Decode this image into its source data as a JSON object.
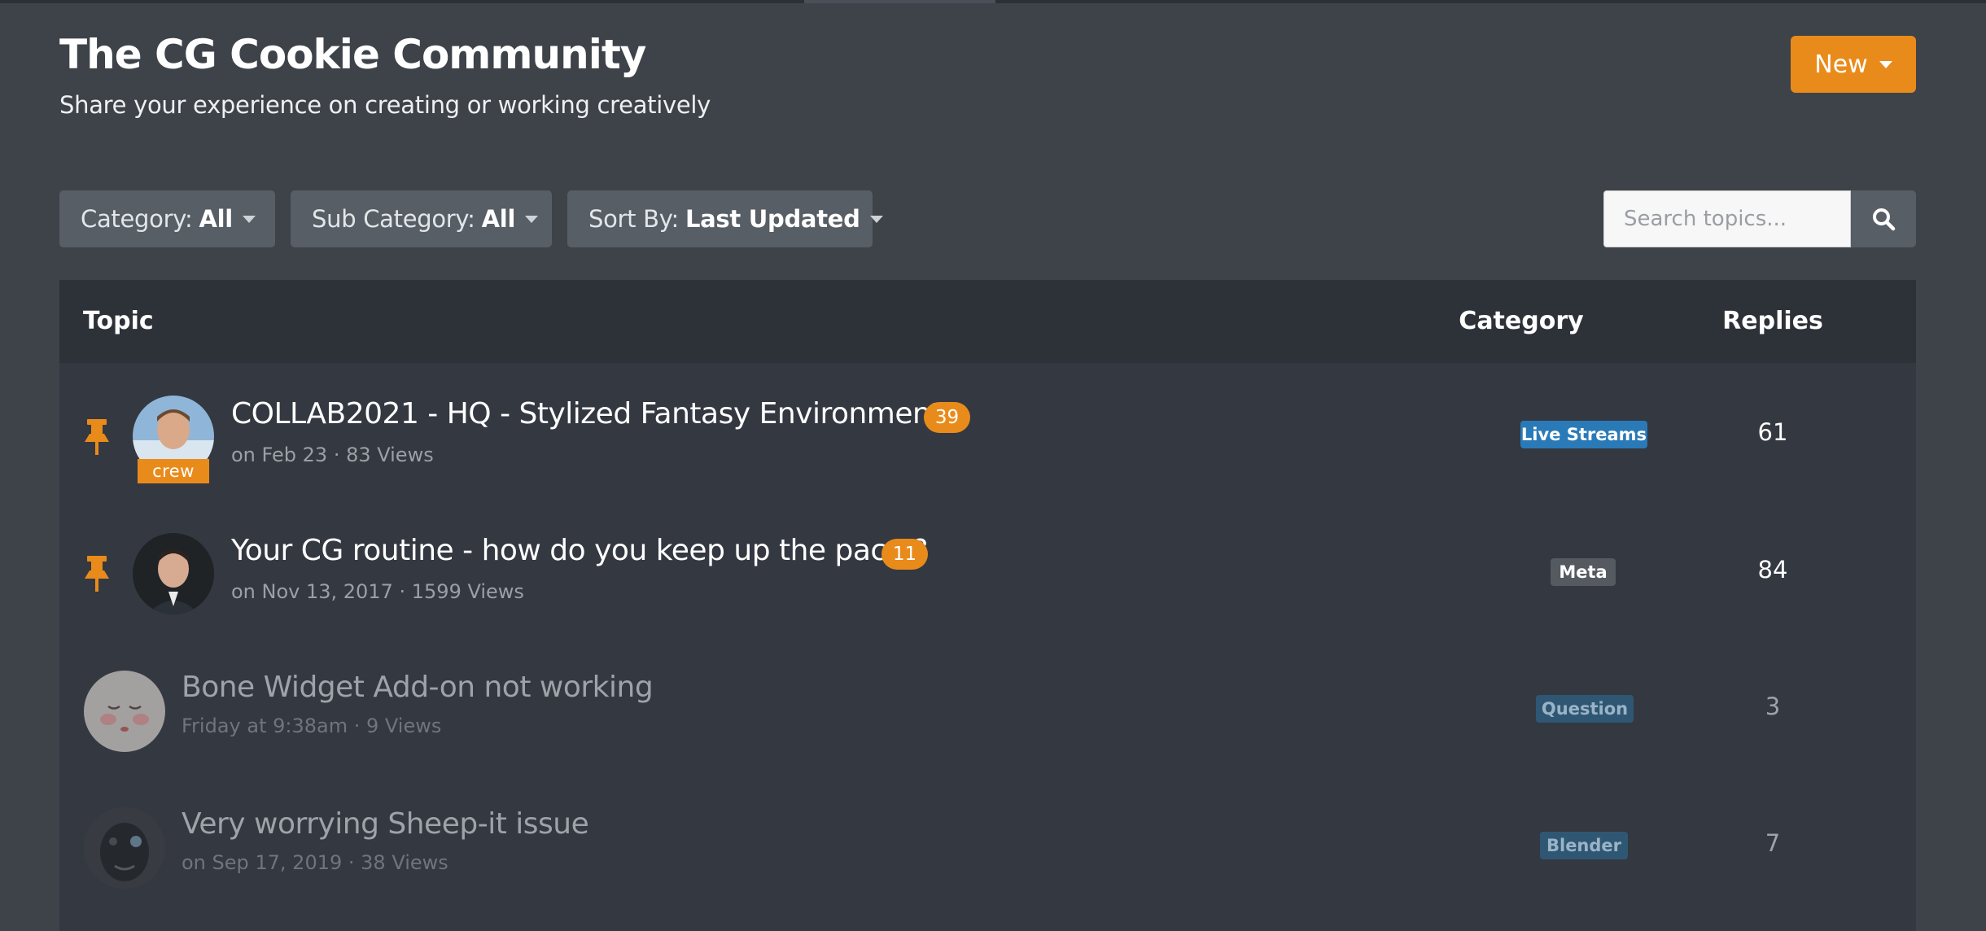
{
  "header": {
    "title": "The CG Cookie Community",
    "subtitle": "Share your experience on creating or working creatively",
    "new_button": "New"
  },
  "filters": {
    "category_label": "Category:",
    "category_value": "All",
    "subcategory_label": "Sub Category:",
    "subcategory_value": "All",
    "sort_label": "Sort By:",
    "sort_value": "Last Updated"
  },
  "search": {
    "placeholder": "Search topics...",
    "value": ""
  },
  "table": {
    "columns": {
      "topic": "Topic",
      "category": "Category",
      "replies": "Replies"
    },
    "rows": [
      {
        "title": "COLLAB2021 - HQ - Stylized Fantasy Environment",
        "meta": "on Feb 23 · 83 Views",
        "pinned": true,
        "new_count": "39",
        "avatar_badge": "crew",
        "category": "Live Streams",
        "category_color": "#2a7ab8",
        "replies": "61"
      },
      {
        "title": "Your CG routine - how do you keep up the pace ?",
        "meta": "on Nov 13, 2017 · 1599 Views",
        "pinned": true,
        "new_count": "11",
        "category": "Meta",
        "category_color": "#555a61",
        "replies": "84"
      },
      {
        "title": "Bone Widget Add-on not working",
        "meta": "Friday at 9:38am · 9 Views",
        "pinned": false,
        "category": "Question",
        "category_color": "#2f5774",
        "replies": "3"
      },
      {
        "title": "Very worrying Sheep-it issue",
        "meta": "on Sep 17, 2019 · 38 Views",
        "pinned": false,
        "category": "Blender",
        "category_color": "#2f5774",
        "replies": "7"
      }
    ]
  },
  "colors": {
    "accent": "#e98b1b",
    "background": "#3e4349",
    "table_header": "#2d3138",
    "table_body": "#343841"
  }
}
